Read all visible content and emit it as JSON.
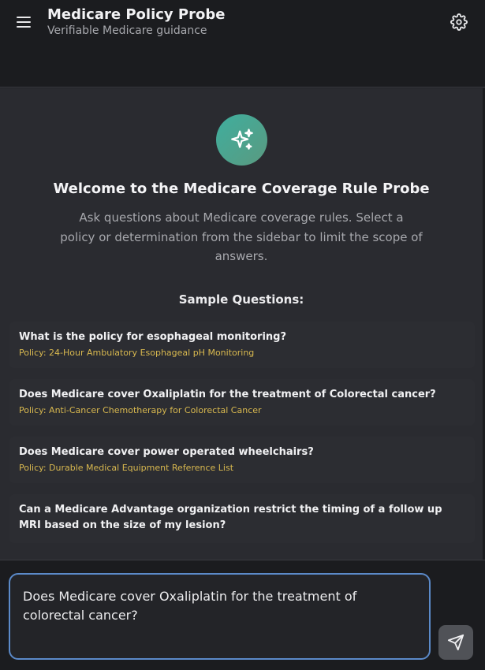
{
  "header": {
    "title": "Medicare Policy Probe",
    "subtitle": "Verifiable Medicare guidance",
    "menu_icon": "hamburger-menu-icon",
    "settings_icon": "gear-icon"
  },
  "welcome": {
    "icon": "sparkles-icon",
    "title": "Welcome to the Medicare Coverage Rule Probe",
    "description": "Ask questions about Medicare coverage rules. Select a policy or determination from the sidebar to limit the scope of answers."
  },
  "samples": {
    "heading": "Sample Questions:",
    "items": [
      {
        "question": "What is the policy for esophageal monitoring?",
        "policy": "Policy: 24-Hour Ambulatory Esophageal pH Monitoring"
      },
      {
        "question": "Does Medicare cover Oxaliplatin for the treatment of Colorectal cancer?",
        "policy": "Policy: Anti-Cancer Chemotherapy for Colorectal Cancer"
      },
      {
        "question": "Does Medicare cover power operated wheelchairs?",
        "policy": "Policy: Durable Medical Equipment Reference List"
      },
      {
        "question": "Can a Medicare Advantage organization restrict the timing of a follow up MRI based on the size of my lesion?",
        "policy": ""
      }
    ]
  },
  "input": {
    "value": "Does Medicare cover Oxaliplatin for the treatment of colorectal cancer?",
    "send_icon": "send-icon"
  },
  "colors": {
    "accent": "#5b8ac9",
    "policy_text": "#d8b84f",
    "hero_gradient_start": "#3fae9e"
  }
}
